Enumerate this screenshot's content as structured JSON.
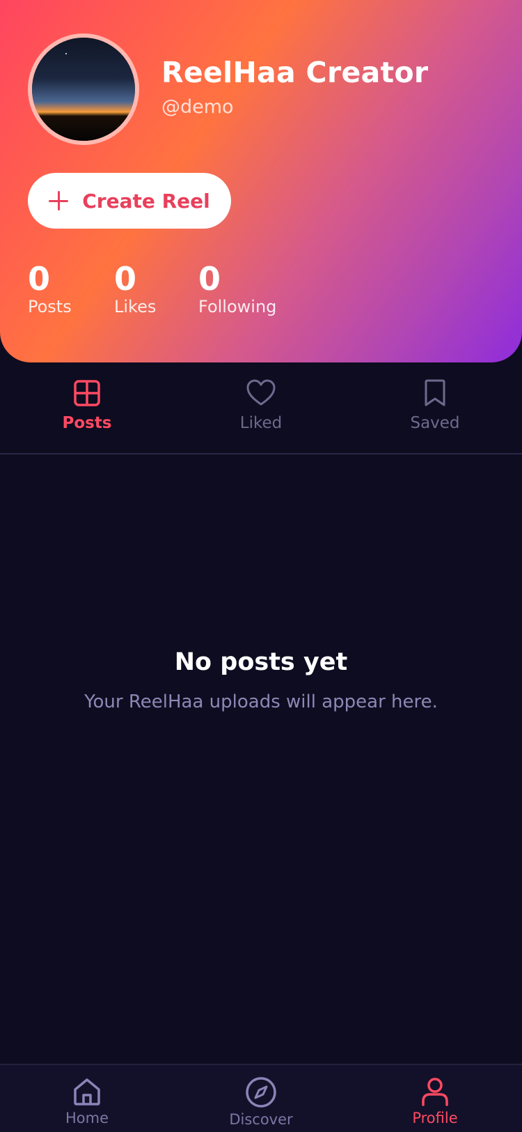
{
  "profile": {
    "name": "ReelHaa Creator",
    "handle": "@demo",
    "create_label": "Create Reel"
  },
  "stats": [
    {
      "value": "0",
      "label": "Posts"
    },
    {
      "value": "0",
      "label": "Likes"
    },
    {
      "value": "0",
      "label": "Following"
    }
  ],
  "tabs": [
    {
      "label": "Posts",
      "icon": "grid-icon",
      "active": true
    },
    {
      "label": "Liked",
      "icon": "heart-icon",
      "active": false
    },
    {
      "label": "Saved",
      "icon": "bookmark-icon",
      "active": false
    }
  ],
  "empty_state": {
    "title": "No posts yet",
    "subtitle": "Your ReelHaa uploads will appear here."
  },
  "bottom_nav": [
    {
      "label": "Home",
      "icon": "home-icon",
      "active": false
    },
    {
      "label": "Discover",
      "icon": "compass-icon",
      "active": false
    },
    {
      "label": "Profile",
      "icon": "user-icon",
      "active": true
    }
  ],
  "colors": {
    "accent": "#ff4a63",
    "background": "#0e0c20",
    "muted": "#6e6a8e"
  }
}
